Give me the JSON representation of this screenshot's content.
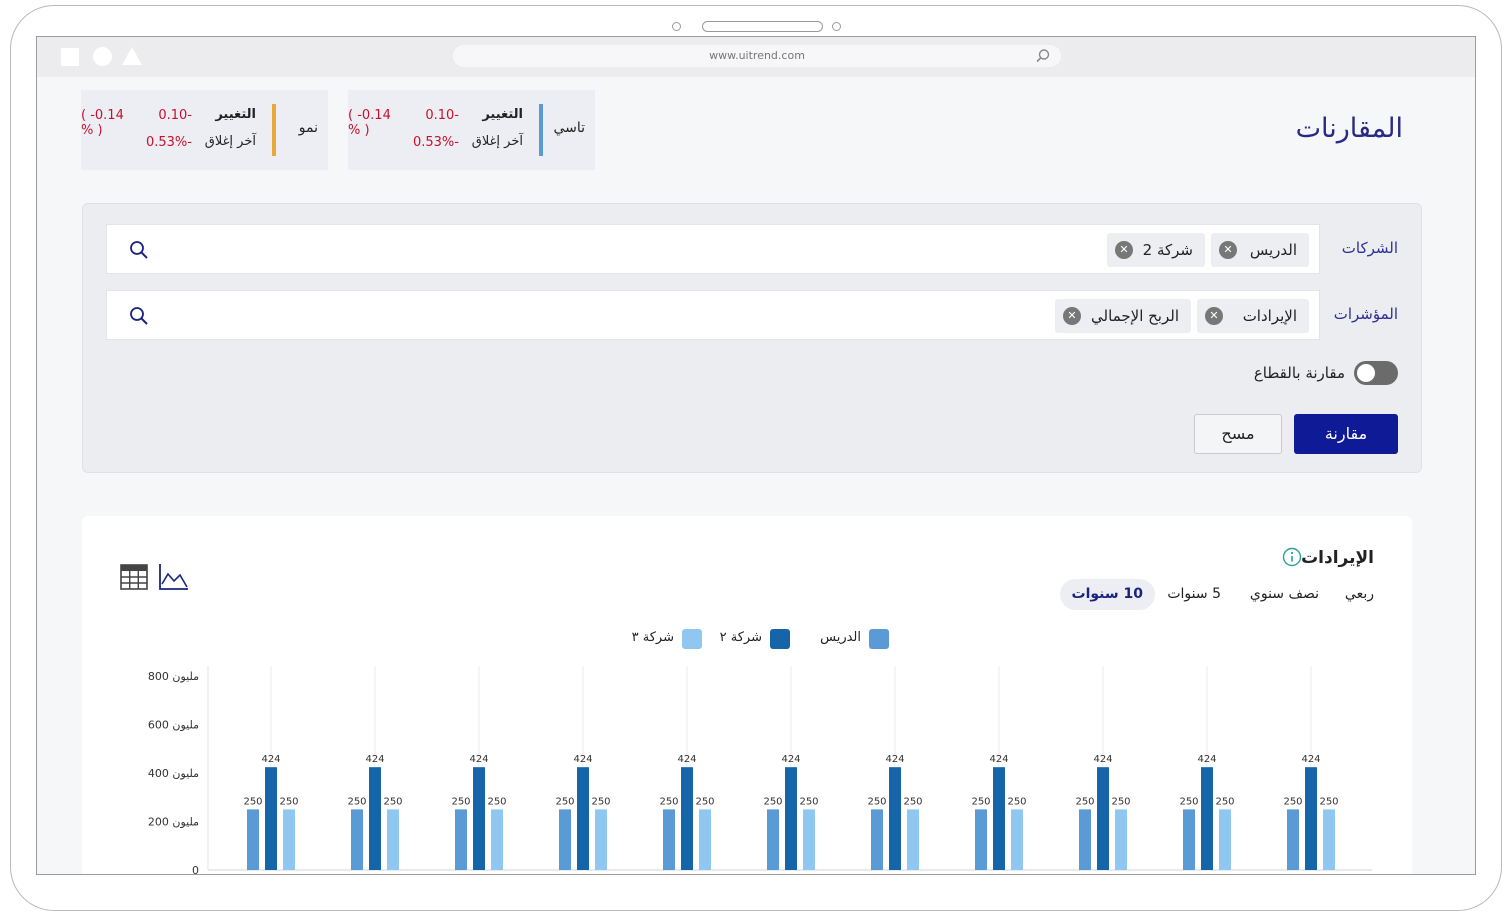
{
  "browser": {
    "url": "www.uitrend.com"
  },
  "page": {
    "title": "المقارنات"
  },
  "stocks": [
    {
      "name": "تاسي",
      "change_label": "التغيير",
      "change_value": "-0.10",
      "change_percent": "( -0.14 % )",
      "close_label": "آخر إغلاق",
      "close_value": "-0.53%",
      "accent": "#5b9bd5"
    },
    {
      "name": "نمو",
      "change_label": "التغيير",
      "change_value": "-0.10",
      "change_percent": "( -0.14 % )",
      "close_label": "آخر إغلاق",
      "close_value": "-0.53%",
      "accent": "#e6a93a"
    }
  ],
  "filters": {
    "companies": {
      "label": "الشركات",
      "chips": [
        "الدريس",
        "شركة 2"
      ]
    },
    "indicators": {
      "label": "المؤشرات",
      "chips": [
        "الإيرادات",
        "الربح الإجمالي"
      ]
    },
    "sector_toggle": {
      "label": "مقارنة بالقطاع",
      "on": false
    },
    "compare_button": "مقارنة",
    "clear_button": "مسح"
  },
  "chart_card": {
    "title": "الإيرادات",
    "periods": [
      "ربعي",
      "نصف سنوي",
      "5 سنوات",
      "10 سنوات"
    ],
    "active_period": "10 سنوات"
  },
  "chart_data": {
    "type": "bar",
    "title": "",
    "xlabel": "",
    "ylabel": "",
    "categories": [
      "",
      "",
      "",
      "",
      "",
      "",
      "",
      "",
      "",
      "",
      ""
    ],
    "ylim": [
      0,
      800
    ],
    "yticks": [
      "0",
      "200 مليون",
      "400 مليون",
      "600 مليون",
      "800 مليون"
    ],
    "grid": true,
    "legend_position": "top",
    "series": [
      {
        "name": "الدريس",
        "color": "#5b9bd5",
        "values": [
          250,
          250,
          250,
          250,
          250,
          250,
          250,
          250,
          250,
          250,
          250
        ]
      },
      {
        "name": "شركة ٢",
        "color": "#1565a8",
        "values": [
          424,
          424,
          424,
          424,
          424,
          424,
          424,
          424,
          424,
          424,
          424
        ]
      },
      {
        "name": "شركة ٣",
        "color": "#90c7f0",
        "values": [
          250,
          250,
          250,
          250,
          250,
          250,
          250,
          250,
          250,
          250,
          250
        ]
      }
    ]
  }
}
